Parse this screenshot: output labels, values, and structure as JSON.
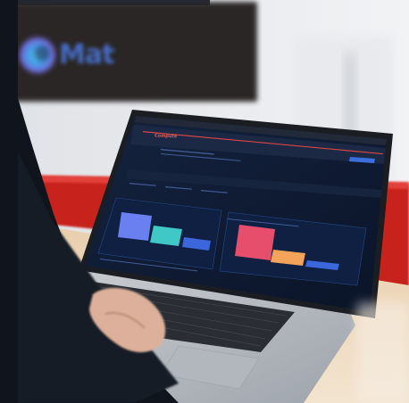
{
  "photo": {
    "background_logo_text": "Mat",
    "screen_brand_text": "Compute",
    "colors": {
      "wall": "#e7eaee",
      "tv_frame": "#2c2a28",
      "red_panel": "#c8221d",
      "desk": "#e6ccaa",
      "laptop_body": "#b9bec4",
      "screen_bg": "#0e1a33",
      "bar_blue": "#6a7ff0",
      "bar_teal": "#3fc8c6",
      "bar_red": "#e64e6c",
      "bar_orange": "#f3a35a",
      "bar_blue2": "#3b66dc",
      "sleeve": "#10151d",
      "hand": "#dcb09a"
    }
  }
}
